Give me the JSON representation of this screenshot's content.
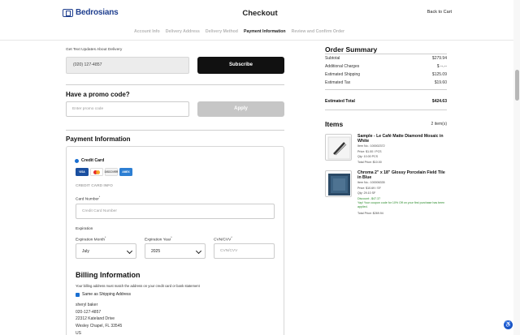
{
  "header": {
    "logo_text": "Bedrosians",
    "title": "Checkout",
    "back_link": "Back to Cart"
  },
  "steps": [
    "Account Info",
    "Delivery Address",
    "Delivery Method",
    "Payment Information",
    "Review and Confirm Order"
  ],
  "text_updates": {
    "label": "Get Text Updates About Delivery",
    "phone_value": "(020) 127-4857",
    "subscribe_label": "Subscribe"
  },
  "promo": {
    "title": "Have a promo code?",
    "placeholder": "Enter promo code",
    "apply_label": "Apply"
  },
  "payment": {
    "title": "Payment Information",
    "method_label": "Credit Card",
    "cards": [
      "VISA",
      "MC",
      "DISCOVER",
      "AMEX"
    ],
    "cc_info_label": "CREDIT CARD INFO",
    "card_number_label": "Card Number",
    "card_number_placeholder": "Credit Card Number",
    "expiration_label": "Expiration",
    "exp_month_label": "Expiration Month",
    "exp_month_value": "July",
    "exp_year_label": "Expiration Year",
    "exp_year_value": "2025",
    "cvv_label": "CVN/CVV",
    "cvv_placeholder": "CVN/CVV"
  },
  "billing": {
    "title": "Billing Information",
    "note": "Your billing address must match the address on your credit card or bank statement",
    "same_as_shipping": "Same as Shipping Address",
    "address_lines": [
      "sheryl baker",
      "020-127-4857",
      "22312 Kateland Drive",
      "Wesley Chapel, FL 33545",
      "US"
    ]
  },
  "summary": {
    "title": "Order Summary",
    "rows": [
      {
        "label": "Subtotal",
        "value": "$279.94"
      },
      {
        "label": "Additional Charges",
        "value": "$ --.--"
      },
      {
        "label": "Estimated Shipping",
        "value": "$125.09"
      },
      {
        "label": "Estimated Tax",
        "value": "$19.60"
      }
    ],
    "total_label": "Estimated Total",
    "total_value": "$424.63"
  },
  "items": {
    "title": "Items",
    "count": "2 item(s)",
    "list": [
      {
        "name": "Sample - Le Café Matte Diamond Mosaic in White",
        "meta": [
          "Item No.: 100002372",
          "Price: $1.00 / PCS",
          "Qty: 10.00 PCS",
          "Total Price: $10.00"
        ]
      },
      {
        "name": "Chroma 2\" x 18\" Glossy Porcelain Field Tile in Blue",
        "meta": [
          "Item No.: 100006335",
          "Price: $10.69 / SF",
          "Qty: 29.10 SF",
          "Discount: -$47.37"
        ],
        "promo_note": "Yay! Your coupon code for 10% Off on your first purchase has been applied.",
        "total": "Total Price: $269.94"
      }
    ]
  },
  "colors": {
    "brand": "#1f3f8f",
    "primary_button": "#111111",
    "disabled_button": "#c6c6c6",
    "accent": "#1a6fd1",
    "success": "#2a8a2a"
  }
}
